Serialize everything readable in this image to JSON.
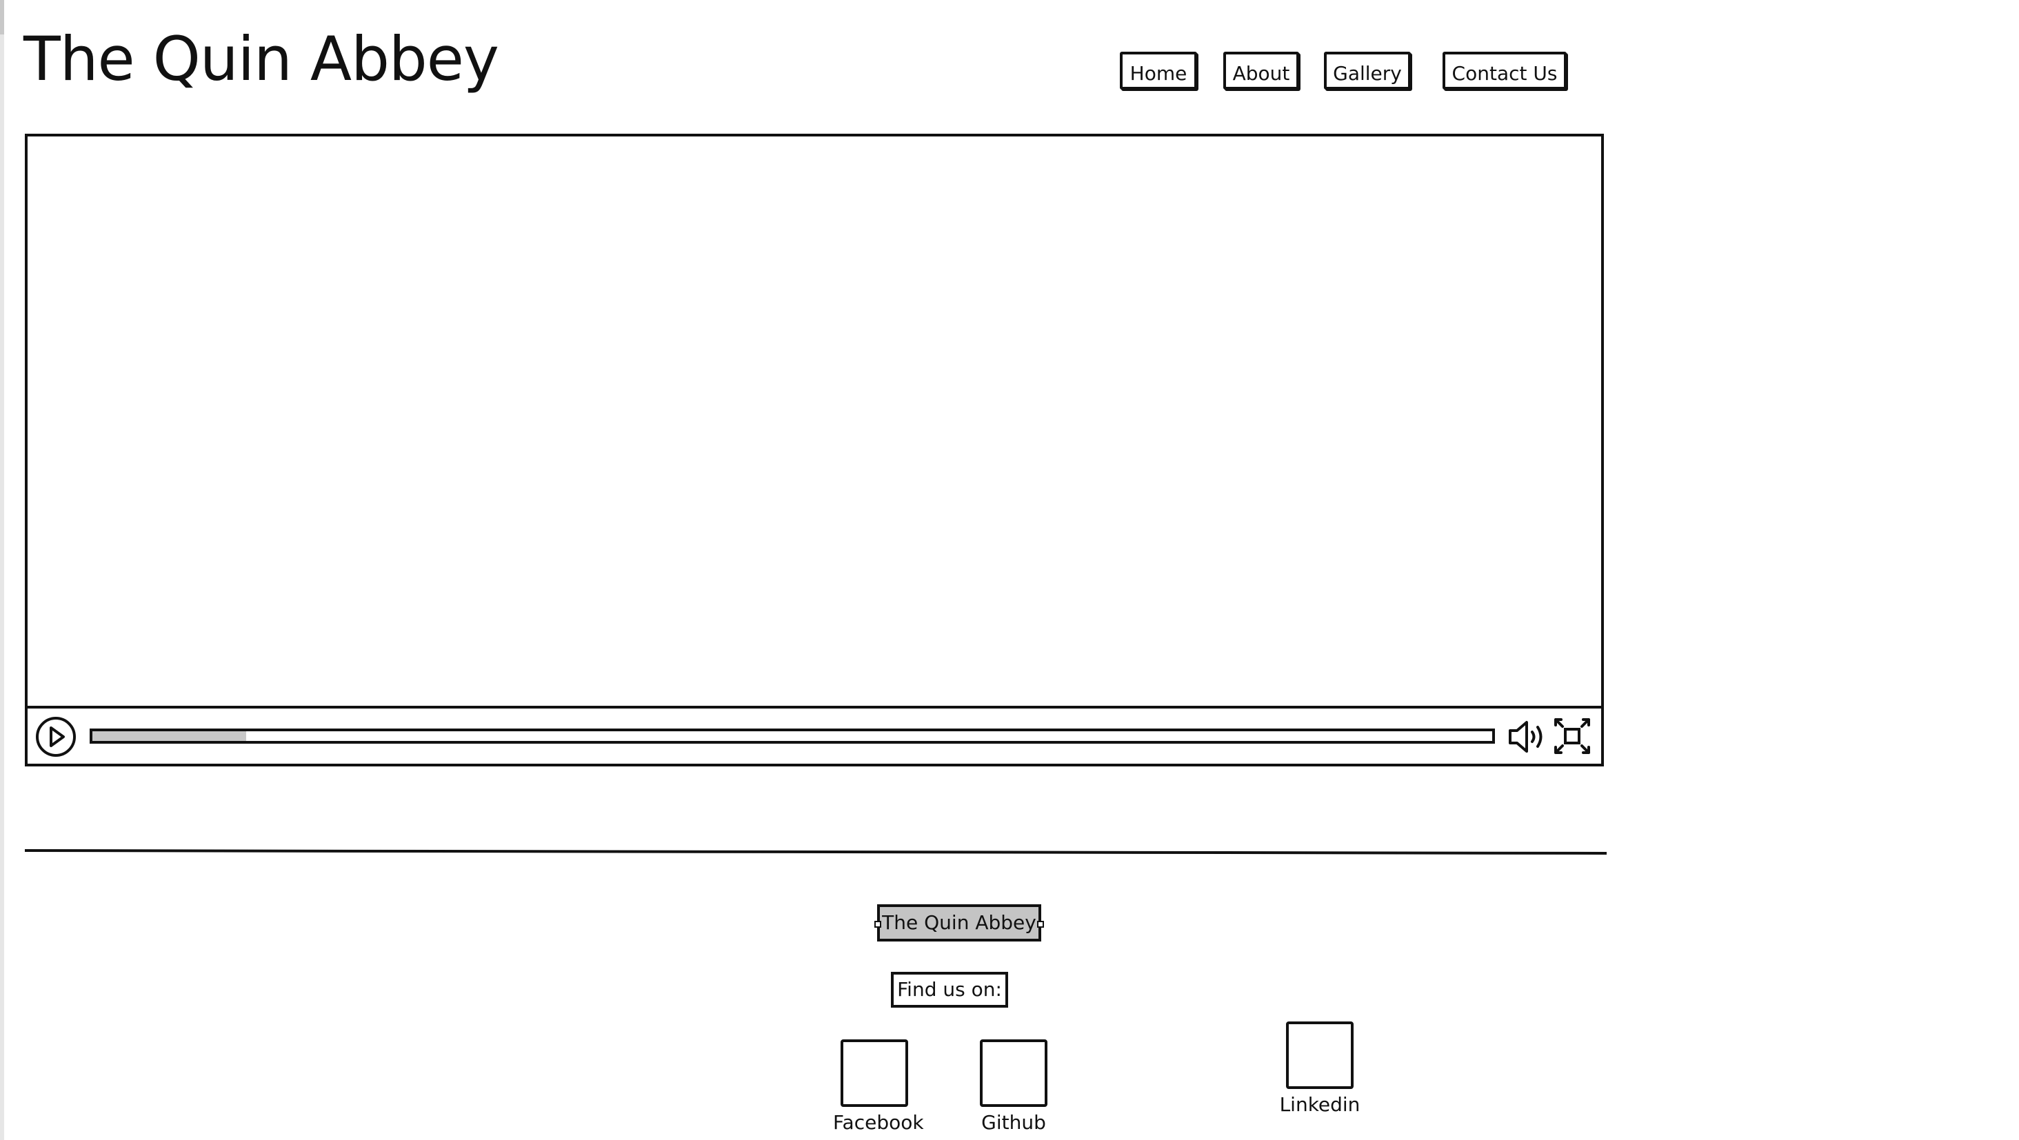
{
  "header": {
    "title": "The Quin Abbey"
  },
  "nav": {
    "items": [
      {
        "label": "Home"
      },
      {
        "label": "About"
      },
      {
        "label": "Gallery"
      },
      {
        "label": "Contact Us"
      }
    ]
  },
  "video": {
    "progress_fraction": 0.11,
    "icons": [
      "play-icon",
      "volume-icon",
      "fullscreen-icon"
    ]
  },
  "footer": {
    "title": "The Quin Abbey",
    "find_us": "Find us on:",
    "social": [
      {
        "label": "Facebook"
      },
      {
        "label": "Github"
      },
      {
        "label": "Linkedin"
      }
    ]
  }
}
